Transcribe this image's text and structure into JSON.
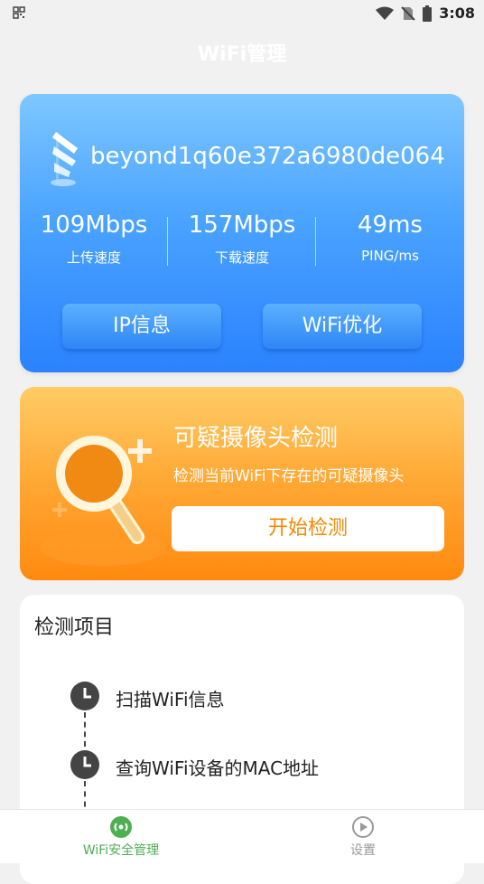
{
  "status_bar": {
    "time": "3:08"
  },
  "header": {
    "title": "WiFi管理"
  },
  "wifi_card": {
    "ssid": "beyond1q60e372a6980de064",
    "stats": [
      {
        "value": "109Mbps",
        "label": "上传速度"
      },
      {
        "value": "157Mbps",
        "label": "下载速度"
      },
      {
        "value": "49ms",
        "label": "PING/ms"
      }
    ],
    "buttons": {
      "ip_info": "IP信息",
      "wifi_optimize": "WiFi优化"
    }
  },
  "camera_card": {
    "title": "可疑摄像头检测",
    "description": "检测当前WiFi下存在的可疑摄像头",
    "button": "开始检测"
  },
  "check_card": {
    "title": "检测项目",
    "steps": [
      {
        "label": "扫描WiFi信息"
      },
      {
        "label": "查询WiFi设备的MAC地址"
      }
    ]
  },
  "bottom_nav": {
    "items": [
      {
        "label": "WiFi安全管理",
        "color": "#4caf50"
      },
      {
        "label": "设置",
        "color": "#999999"
      }
    ]
  }
}
